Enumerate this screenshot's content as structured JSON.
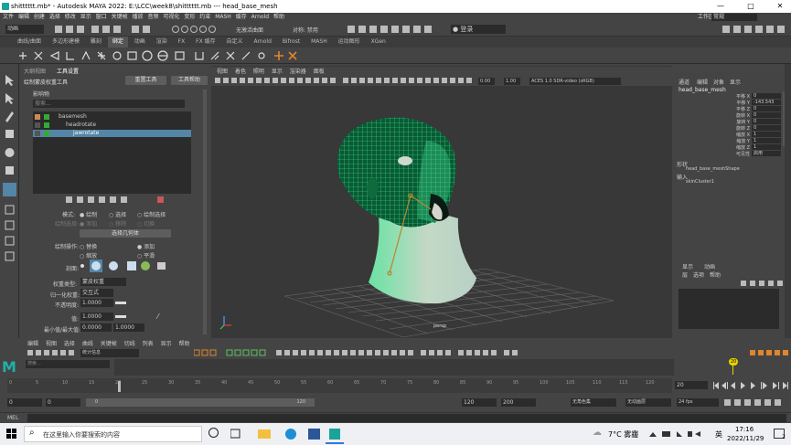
{
  "window": {
    "title": "shitttttt.mb* - Autodesk MAYA 2022: E:\\LCC\\week8\\shitttttt.mb   ---   head_base_mesh",
    "min": "—",
    "max": "□",
    "close": "✕"
  },
  "menubar": {
    "items": [
      "文件",
      "编辑",
      "创建",
      "选择",
      "修改",
      "显示",
      "窗口",
      "关键帧",
      "播放",
      "音频",
      "可视化",
      "变形",
      "约束",
      "MASH",
      "缓存",
      "Arnold",
      "帮助"
    ],
    "workspace_label": "工作区:",
    "workspace_value": "常规"
  },
  "statusline": {
    "mode": "动画",
    "no_live": "无激活曲面",
    "symmetry": "对称: 禁用",
    "login": "登录"
  },
  "shelf_tabs": {
    "items": [
      "曲线/曲面",
      "多边形建模",
      "雕刻",
      "绑定",
      "动画",
      "渲染",
      "FX",
      "FX 缓存",
      "自定义",
      "Arnold",
      "Bifrost",
      "MASH",
      "运动图形",
      "XGen"
    ],
    "active_index": 3
  },
  "tool_panel": {
    "tabs": [
      "大纲视图",
      "工具设置"
    ],
    "reset_tool": "重置工具",
    "tool_help": "工具帮助",
    "tool_name": "绘制蒙皮权重工具",
    "section_influence": "影响物",
    "search_placeholder": "搜索...",
    "joints": [
      "basemesh",
      "headrotate",
      "jawrotate"
    ],
    "mode_label": "模式:",
    "mode_options": [
      "绘制",
      "选择",
      "绘制选择"
    ],
    "paint_select_label": "绘制选择:",
    "paint_select_options": [
      "添加",
      "移除",
      "切换"
    ],
    "select_geometry_button": "选择几何体",
    "paint_op_label": "绘制操作:",
    "paint_ops": [
      "替换",
      "添加",
      "缩放",
      "平滑"
    ],
    "profile_label": "剖面:",
    "weight_type_label": "权重类型:",
    "weight_type_value": "蒙皮权重",
    "normalize_label": "归一化权重:",
    "normalize_value": "交互式",
    "opacity_label": "不透明度:",
    "opacity_value": "1.0000",
    "value_label": "值:",
    "value_value": "1.0000",
    "minmax_label": "最小值/最大值:",
    "min_value": "0.0000",
    "max_value": "1.0000"
  },
  "viewport": {
    "menu": [
      "视图",
      "着色",
      "照明",
      "显示",
      "渲染器",
      "面板"
    ],
    "camera": "persp",
    "field_a": "0.00",
    "field_b": "1.00",
    "colorspace": "ACES 1.0 SDR-video (sRGB)"
  },
  "channel_box": {
    "tabs": [
      "通道",
      "编辑",
      "对象",
      "显示"
    ],
    "object": "head_base_mesh",
    "channels": [
      {
        "name": "平移 X",
        "value": "0"
      },
      {
        "name": "平移 Y",
        "value": "-143.543"
      },
      {
        "name": "平移 Z",
        "value": "0"
      },
      {
        "name": "旋转 X",
        "value": "0"
      },
      {
        "name": "旋转 Y",
        "value": "0"
      },
      {
        "name": "旋转 Z",
        "value": "0"
      },
      {
        "name": "缩放 X",
        "value": "1"
      },
      {
        "name": "缩放 Y",
        "value": "1"
      },
      {
        "name": "缩放 Z",
        "value": "1"
      },
      {
        "name": "可见性",
        "value": "启用"
      }
    ],
    "shapes_label": "形状",
    "shape_name": "head_base_meshShape",
    "inputs_label": "输入",
    "input_name": "skinCluster1",
    "layer_tabs": [
      "显示",
      "动画"
    ],
    "layer_menu": [
      "层",
      "选项",
      "帮助"
    ]
  },
  "timeline": {
    "ticks": [
      "0",
      "5",
      "10",
      "15",
      "20",
      "25",
      "30",
      "35",
      "40",
      "45",
      "50",
      "55",
      "60",
      "65",
      "70",
      "75",
      "80",
      "85",
      "90",
      "95",
      "100",
      "105",
      "110",
      "115",
      "120"
    ],
    "current_frame": "20",
    "playhead_label": "20",
    "range_start": "0",
    "range_start2": "0",
    "range_inner_start": "0",
    "range_inner_end": "120",
    "range_end": "120",
    "range_end2": "200",
    "char_set": "无角色集",
    "anim_layer": "无动画层",
    "fps": "24 fps",
    "mel": "MEL",
    "graph_menu": [
      "编辑",
      "视图",
      "选择",
      "曲线",
      "关键帧",
      "切线",
      "列表",
      "显示",
      "帮助"
    ],
    "stats": "统计信息",
    "search_placeholder": "搜索..."
  },
  "taskbar": {
    "search_placeholder": "在这里输入你要搜索的内容",
    "weather": "7°C 雾霾",
    "ime": "英",
    "time": "17:16",
    "date": "2022/11/29",
    "notif": "2"
  },
  "colors": {
    "wire": "#3be892",
    "wire_dark": "#0a5a34",
    "skin": "#d8d8cf",
    "selected_row": "#5285a6",
    "timeline_playhead": "#e8d400",
    "maya_logo": "#20b0a8"
  }
}
